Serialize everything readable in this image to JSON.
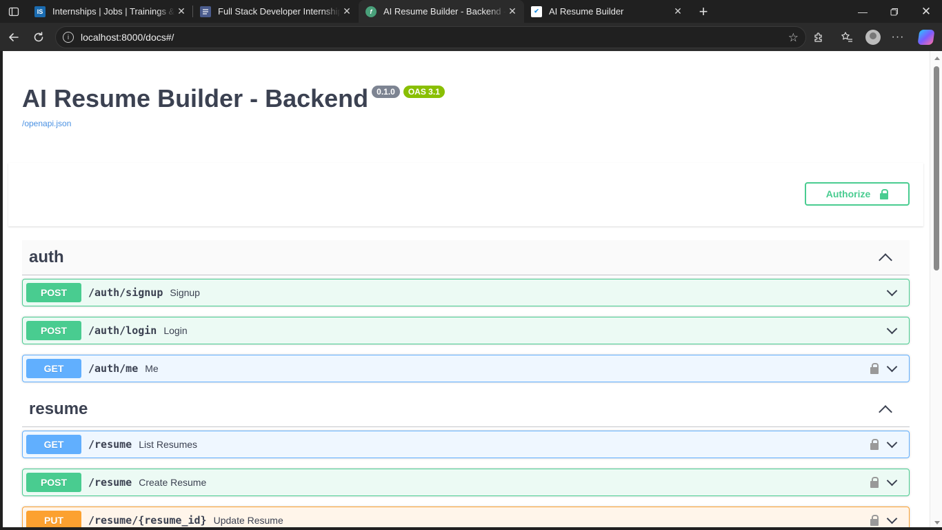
{
  "browser": {
    "tabs": [
      {
        "title": "Internships | Jobs | Trainings & Placements",
        "favicon": "IS"
      },
      {
        "title": "Full Stack Developer Internship – Internshala",
        "favicon": "doc"
      },
      {
        "title": "AI Resume Builder - Backend - Swagger UI",
        "favicon": "swagger"
      },
      {
        "title": "AI Resume Builder",
        "favicon": "check"
      }
    ],
    "address": "localhost:8000/docs#/"
  },
  "info": {
    "title": "AI Resume Builder - Backend",
    "version": "0.1.0",
    "oas": "OAS 3.1",
    "spec_link": "/openapi.json"
  },
  "authorize_label": "Authorize",
  "tags": [
    {
      "name": "auth"
    },
    {
      "name": "resume"
    }
  ],
  "operations": [
    {
      "method": "POST",
      "path": "/auth/signup",
      "summary": "Signup"
    },
    {
      "method": "POST",
      "path": "/auth/login",
      "summary": "Login"
    },
    {
      "method": "GET",
      "path": "/auth/me",
      "summary": "Me"
    },
    {
      "method": "GET",
      "path": "/resume",
      "summary": "List Resumes"
    },
    {
      "method": "POST",
      "path": "/resume",
      "summary": "Create Resume"
    },
    {
      "method": "PUT",
      "path": "/resume/{resume_id}",
      "summary": "Update Resume"
    }
  ],
  "colors": {
    "post": "#49cc90",
    "get": "#61affe",
    "put": "#fca130",
    "title": "#3b4151"
  }
}
